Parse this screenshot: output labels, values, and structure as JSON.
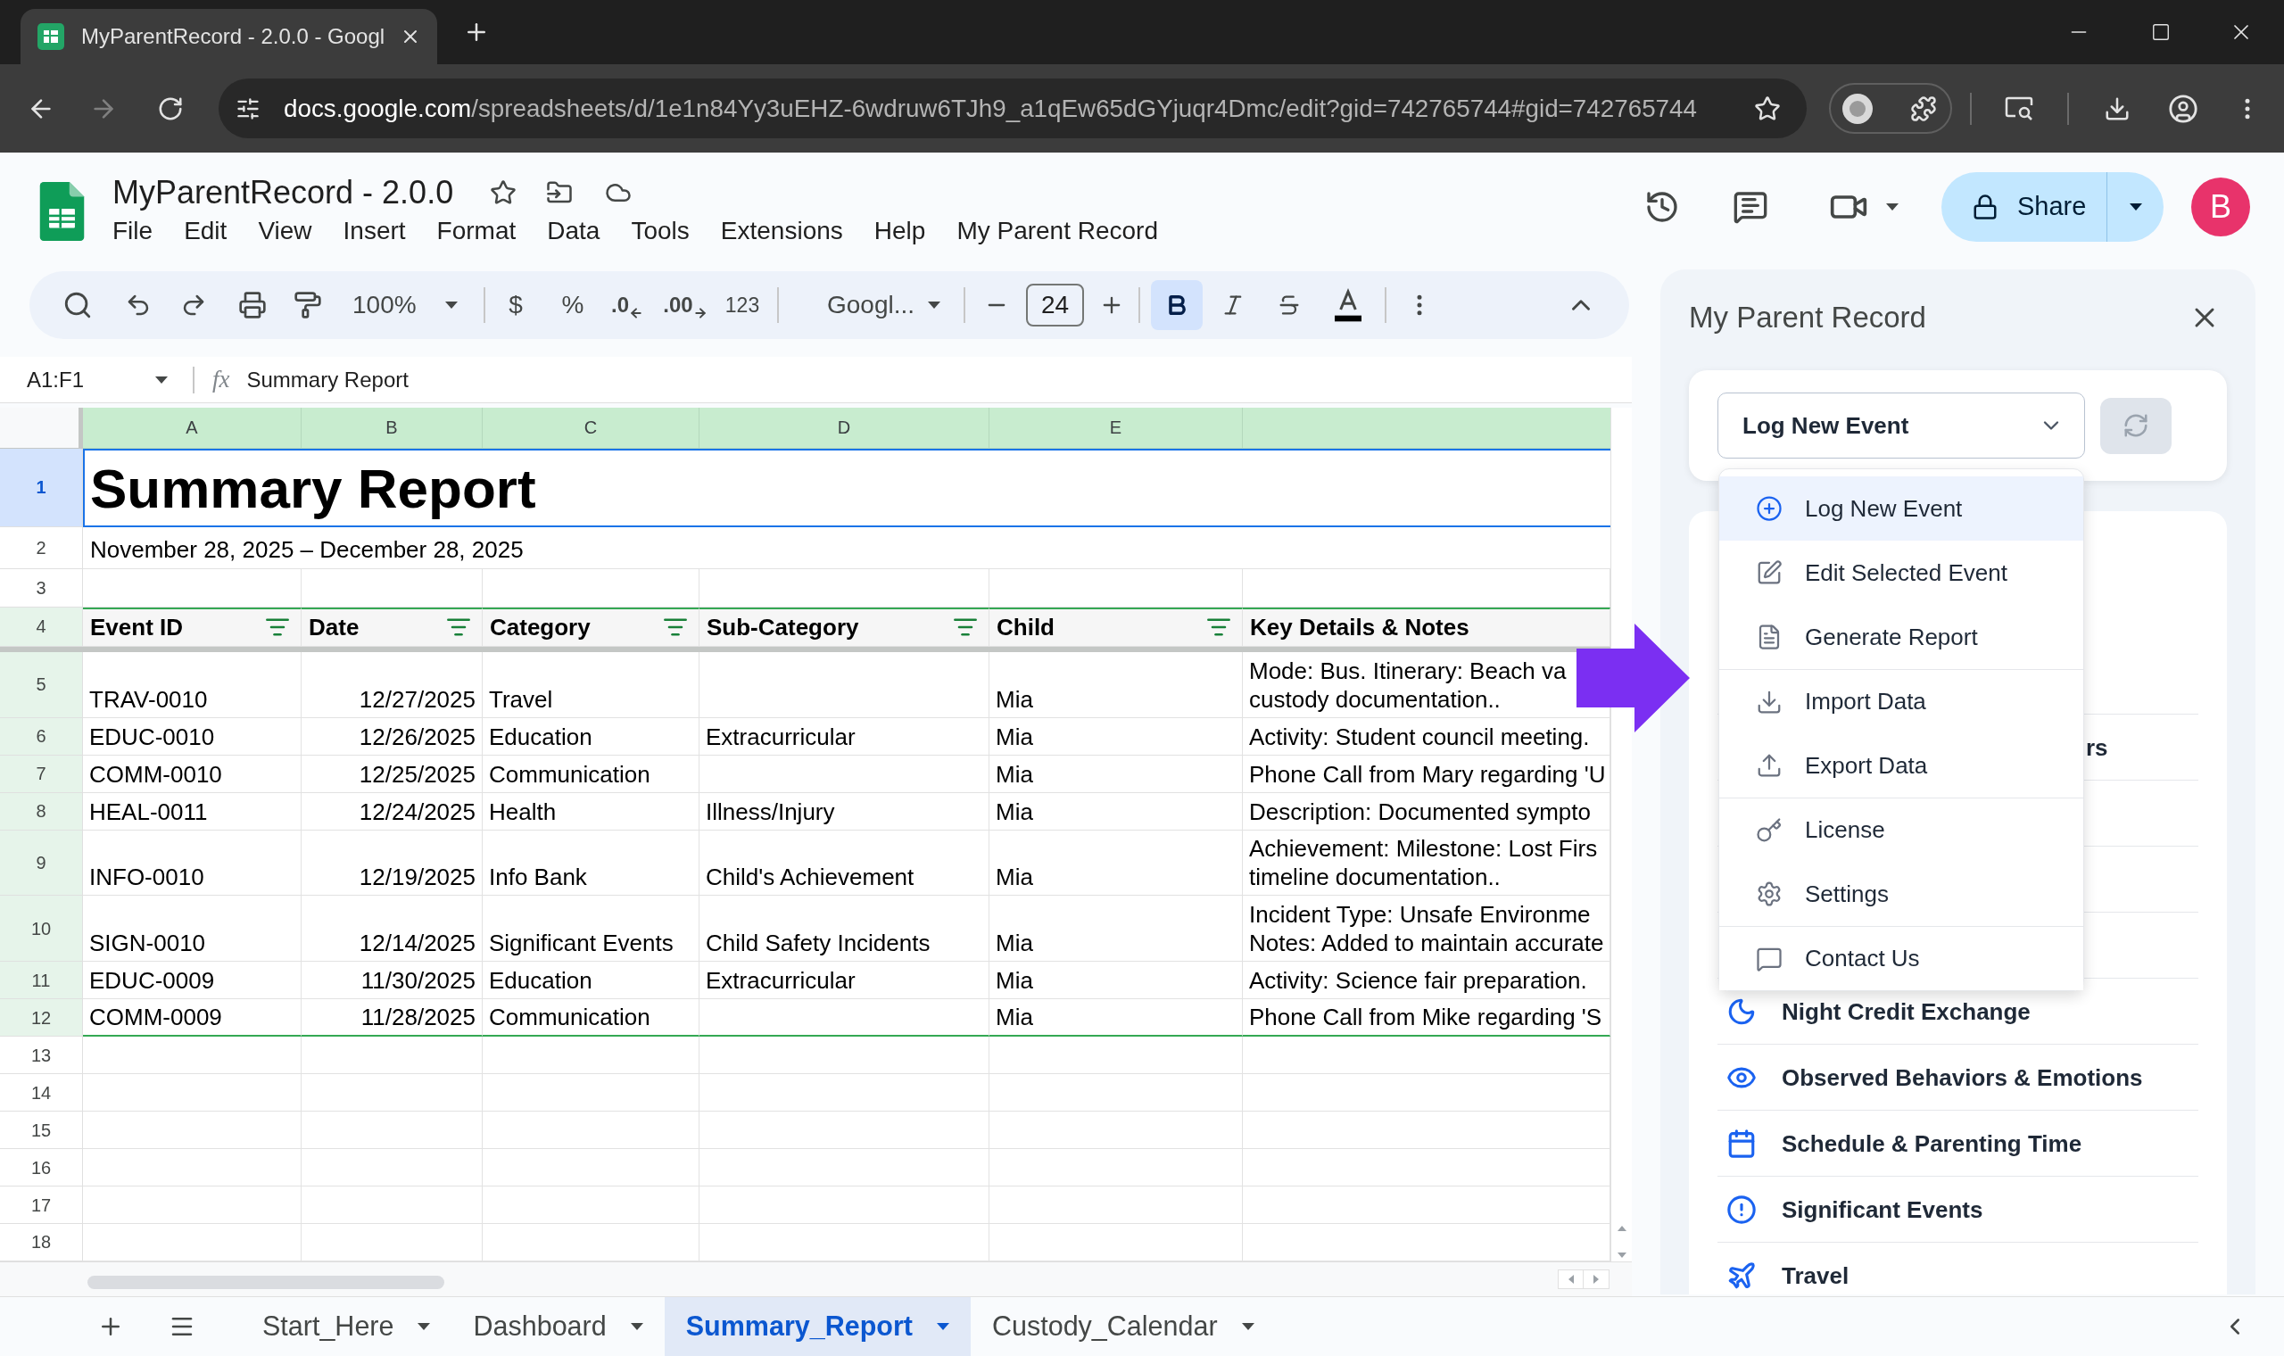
{
  "browser": {
    "tab": {
      "title": "MyParentRecord - 2.0.0 - Googl",
      "selected": true
    },
    "address": {
      "host": "docs.google.com",
      "path": "/spreadsheets/d/1e1n84Yy3uEHZ-6wdruw6TJh9_a1qEw65dGYjuqr4Dmc/edit?gid=742765744#gid=742765744"
    }
  },
  "document": {
    "title": "MyParentRecord - 2.0.0",
    "menu": [
      "File",
      "Edit",
      "View",
      "Insert",
      "Format",
      "Data",
      "Tools",
      "Extensions",
      "Help",
      "My Parent Record"
    ],
    "share": "Share",
    "avatar": "B"
  },
  "toolbar": {
    "zoom": "100%",
    "currency": "$",
    "percent": "%",
    "decrease_decimal": ".0",
    "increase_decimal": ".00",
    "number_format": "123",
    "font": "Googl...",
    "font_size": "24",
    "styles": [
      {
        "kind": "bold",
        "on": true
      },
      {
        "kind": "italic",
        "on": false
      },
      {
        "kind": "strikethrough",
        "on": false
      }
    ]
  },
  "formula_bar": {
    "range": "A1:F1",
    "function_label": "fx",
    "content": "Summary Report"
  },
  "grid": {
    "columns": [
      "A",
      "B",
      "C",
      "D",
      "E"
    ],
    "rows": [
      {
        "number": "1",
        "kind": "title",
        "selected": true,
        "text": "Summary Report"
      },
      {
        "number": "2",
        "kind": "subtitle",
        "selected": false,
        "text": "November 28, 2025 – December 28, 2025"
      },
      {
        "number": "3",
        "kind": "blank",
        "selected": false
      },
      {
        "number": "4",
        "kind": "header",
        "selected": false,
        "cells": [
          {
            "text": "Event ID",
            "filter": true
          },
          {
            "text": "Date",
            "filter": true
          },
          {
            "text": "Category",
            "filter": true
          },
          {
            "text": "Sub-Category",
            "filter": true
          },
          {
            "text": "Child",
            "filter": true
          },
          {
            "text": "Key Details & Notes",
            "filter": false
          }
        ]
      },
      {
        "number": "5",
        "kind": "data",
        "selected": false,
        "event_id": "TRAV-0010",
        "date": "12/27/2025",
        "category": "Travel",
        "child": "Mia",
        "notes": [
          "Mode: Bus. Itinerary: Beach va",
          "custody documentation.."
        ]
      },
      {
        "number": "6",
        "kind": "data",
        "selected": false,
        "event_id": "EDUC-0010",
        "date": "12/26/2025",
        "category": "Education",
        "sub_category": "Extracurricular",
        "child": "Mia",
        "notes": [
          "Activity: Student council meeting."
        ]
      },
      {
        "number": "7",
        "kind": "data",
        "selected": false,
        "event_id": "COMM-0010",
        "date": "12/25/2025",
        "category": "Communication",
        "child": "Mia",
        "notes": [
          "Phone Call from Mary regarding 'U"
        ]
      },
      {
        "number": "8",
        "kind": "data",
        "selected": false,
        "event_id": "HEAL-0011",
        "date": "12/24/2025",
        "category": "Health",
        "sub_category": "Illness/Injury",
        "child": "Mia",
        "notes": [
          "Description: Documented sympto"
        ]
      },
      {
        "number": "9",
        "kind": "data",
        "selected": false,
        "event_id": "INFO-0010",
        "date": "12/19/2025",
        "category": "Info Bank",
        "sub_category": "Child's Achievement",
        "child": "Mia",
        "notes": [
          "Achievement: Milestone: Lost Firs",
          "timeline documentation.."
        ]
      },
      {
        "number": "10",
        "kind": "data",
        "selected": false,
        "event_id": "SIGN-0010",
        "date": "12/14/2025",
        "category": "Significant Events",
        "sub_category": "Child Safety Incidents",
        "child": "Mia",
        "notes": [
          "Incident Type: Unsafe Environme",
          "Notes: Added to maintain accurate"
        ]
      },
      {
        "number": "11",
        "kind": "data",
        "selected": false,
        "event_id": "EDUC-0009",
        "date": "11/30/2025",
        "category": "Education",
        "sub_category": "Extracurricular",
        "child": "Mia",
        "notes": [
          "Activity: Science fair preparation."
        ]
      },
      {
        "number": "12",
        "kind": "data",
        "selected": false,
        "event_id": "COMM-0009",
        "date": "11/28/2025",
        "category": "Communication",
        "child": "Mia",
        "notes": [
          "Phone Call from Mike regarding 'S"
        ]
      },
      {
        "number": "13",
        "kind": "blank",
        "selected": false
      },
      {
        "number": "14",
        "kind": "blank",
        "selected": false
      },
      {
        "number": "15",
        "kind": "blank",
        "selected": false
      },
      {
        "number": "16",
        "kind": "blank",
        "selected": false
      },
      {
        "number": "17",
        "kind": "blank",
        "selected": false
      },
      {
        "number": "18",
        "kind": "blank",
        "selected": false
      }
    ]
  },
  "sheet_tabs": [
    {
      "label": "Start_Here",
      "selected": false
    },
    {
      "label": "Dashboard",
      "selected": false
    },
    {
      "label": "Summary_Report",
      "selected": true
    },
    {
      "label": "Custody_Calendar",
      "selected": false
    }
  ],
  "panel": {
    "title": "My Parent Record",
    "action": {
      "value": "Log New Event",
      "expanded": true
    },
    "menu_groups": [
      {
        "items": [
          {
            "label": "Log New Event",
            "selected": true
          },
          {
            "label": "Edit Selected Event",
            "selected": false
          },
          {
            "label": "Generate Report",
            "selected": false
          }
        ]
      },
      {
        "items": [
          {
            "label": "Import Data",
            "selected": false
          },
          {
            "label": "Export Data",
            "selected": false
          }
        ]
      },
      {
        "items": [
          {
            "label": "License",
            "selected": false
          },
          {
            "label": "Settings",
            "selected": false
          }
        ]
      },
      {
        "items": [
          {
            "label": "Contact Us",
            "selected": false
          }
        ]
      }
    ],
    "list": [
      {
        "kind": "covered",
        "label": "rs"
      },
      {
        "kind": "entry",
        "label": "Night Credit Exchange"
      },
      {
        "kind": "entry",
        "label": "Observed Behaviors & Emotions"
      },
      {
        "kind": "entry",
        "label": "Schedule & Parenting Time"
      },
      {
        "kind": "entry",
        "label": "Significant Events"
      },
      {
        "kind": "entry",
        "label": "Travel"
      }
    ]
  }
}
